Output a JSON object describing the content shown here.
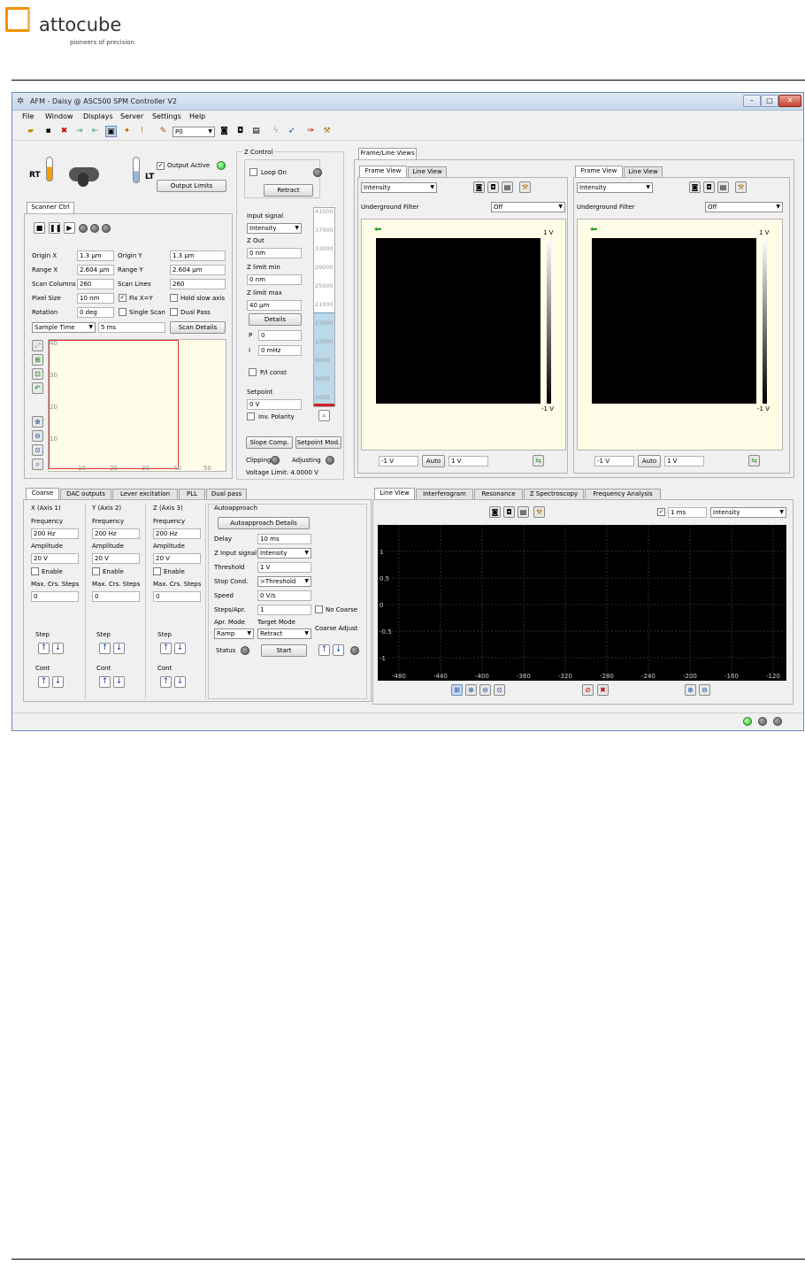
{
  "header": {
    "brand": "attocube",
    "tagline": "pioneers of precision"
  },
  "window": {
    "title": "AFM - Daisy @ ASC500 SPM Controller V2"
  },
  "menu": [
    "File",
    "Window",
    "Displays",
    "Server",
    "Settings",
    "Help"
  ],
  "toolbar": {
    "channel": "P0"
  },
  "temp": {
    "rt": "RT",
    "lt": "LT",
    "output_active": "Output Active",
    "output_limits": "Output Limits"
  },
  "scanner": {
    "tab": "Scanner Ctrl",
    "origin_x_label": "Origin X",
    "origin_x": "1.3 µm",
    "origin_y_label": "Origin Y",
    "origin_y": "1.3 µm",
    "range_x_label": "Range X",
    "range_x": "2.604 µm",
    "range_y_label": "Range Y",
    "range_y": "2.604 µm",
    "scan_columns_label": "Scan Columns",
    "scan_columns": "260",
    "scan_lines_label": "Scan Lines",
    "scan_lines": "260",
    "pixel_size_label": "Pixel Size",
    "pixel_size": "10 nm",
    "fix_xy": "Fix  X=Y",
    "hold_slow": "Hold slow axis",
    "rotation_label": "Rotation",
    "rotation": "0 deg",
    "single_scan": "Single Scan",
    "dual_pass": "Dual Pass",
    "sample_time": "Sample Time",
    "sample_value": "5 ms",
    "scan_details": "Scan Details",
    "yticks": [
      "40",
      "30",
      "20",
      "10"
    ],
    "xticks": [
      "10",
      "20",
      "30",
      "40",
      "50"
    ]
  },
  "zcontrol": {
    "title": "Z Control",
    "loop_on": "Loop On",
    "retract": "Retract",
    "input_signal_label": "Input signal",
    "input_signal": "Intensity",
    "z_out_label": "Z Out",
    "z_out": "0 nm",
    "z_limit_min_label": "Z limit min",
    "z_limit_min": "0 nm",
    "z_limit_max_label": "Z limit max",
    "z_limit_max": "40 µm",
    "details": "Details",
    "p_label": "P",
    "p": "0",
    "i_label": "I",
    "i": "0 mHz",
    "pi_const": "P/I const",
    "setpoint_label": "Setpoint",
    "setpoint": "0 V",
    "inv_polarity": "Inv. Polarity",
    "slope_comp": "Slope Comp.",
    "setpoint_mod": "Setpoint Mod.",
    "clipping": "Clipping",
    "adjusting": "Adjusting",
    "voltage_limit": "Voltage Limit: 4.0000 V",
    "scale": [
      "41000",
      "37000",
      "33000",
      "29000",
      "25000",
      "21000",
      "17000",
      "13000",
      "9000",
      "5000",
      "1000"
    ]
  },
  "frameviews": {
    "title": "Frame/Line Views",
    "left": {
      "tab1": "Frame View",
      "tab2": "Line View",
      "signal": "Intensity",
      "filter_label": "Underground Filter",
      "filter": "Off",
      "top": "1 V",
      "bottom": "-1 V",
      "min": "-1 V",
      "auto": "Auto",
      "max": "1 V"
    },
    "right": {
      "tab1": "Frame View",
      "tab2": "Line View",
      "signal": "Intensity",
      "filter_label": "Underground Filter",
      "filter": "Off",
      "top": "1 V",
      "bottom": "-1 V",
      "min": "-1 V",
      "auto": "Auto",
      "max": "1 V"
    }
  },
  "coarse": {
    "tabs": [
      "Coarse",
      "DAC outputs",
      "Lever excitation",
      "PLL",
      "Dual pass"
    ],
    "axes": [
      {
        "title": "X (Axis 1)",
        "freq": "200 Hz",
        "amp": "20 V",
        "steps": "0"
      },
      {
        "title": "Y (Axis 2)",
        "freq": "200 Hz",
        "amp": "20 V",
        "steps": "0"
      },
      {
        "title": "Z (Axis 3)",
        "freq": "200 Hz",
        "amp": "20 V",
        "steps": "0"
      }
    ],
    "frequency": "Frequency",
    "amplitude": "Amplitude",
    "enable": "Enable",
    "max_steps": "Max. Crs. Steps",
    "step": "Step",
    "cont": "Cont"
  },
  "autoapproach": {
    "title": "Autoapproach",
    "details": "Autoapproach Details",
    "delay_label": "Delay",
    "delay": "10 ms",
    "z_input_label": "Z Input signal",
    "z_input": "Intensity",
    "threshold_label": "Threshold",
    "threshold": "1 V",
    "stop_cond_label": "Stop Cond.",
    "stop_cond": ">Threshold",
    "speed_label": "Speed",
    "speed": "0 V/s",
    "steps_label": "Steps/Apr.",
    "steps": "1",
    "no_coarse": "No Coarse",
    "apr_mode_label": "Apr. Mode",
    "apr_mode": "Ramp",
    "target_mode_label": "Target Mode",
    "target_mode": "Retract",
    "coarse_adjust": "Coarse Adjust",
    "status": "Status",
    "start": "Start"
  },
  "lineview": {
    "tabs": [
      "Line View",
      "Interferogram",
      "Resonance",
      "Z Spectroscopy",
      "Frequency Analysis"
    ],
    "interval": "1 ms",
    "signal": "Intensity",
    "yticks": [
      "1",
      "0.5",
      "0",
      "-0.5",
      "-1"
    ],
    "xticks": [
      "-480",
      "-440",
      "-400",
      "-360",
      "-320",
      "-280",
      "-240",
      "-200",
      "-160",
      "-120"
    ]
  }
}
